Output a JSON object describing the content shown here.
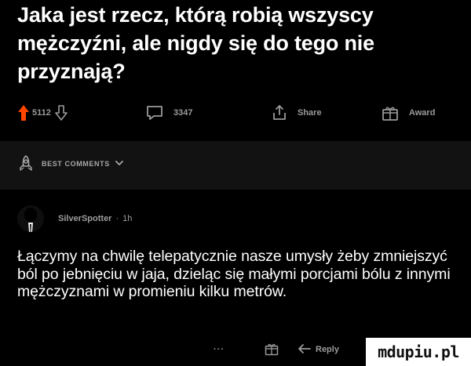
{
  "post": {
    "title": "Jaka jest rzecz, którą robią wszyscy mężczyźni, ale nigdy się do tego nie przyznają?"
  },
  "actions": {
    "upvote_count": "5112",
    "comments_count": "3347",
    "share_label": "Share",
    "award_label": "Award",
    "accent_color": "#ff4500"
  },
  "comments_section": {
    "sort_label": "BEST COMMENTS"
  },
  "comment": {
    "author": "SilverSpotter",
    "separator": "·",
    "time": "1h",
    "body": "Łączymy na chwilę telepatycznie nasze umysły żeby zmniejszyć ból po jebnięciu w jaja, dzieląc się małymi porcjami bólu z innymi mężczyznami w promieniu kilku metrów.",
    "more_label": "···",
    "reply_label": "Reply"
  },
  "watermark": {
    "text": "mdupiu.pl"
  }
}
